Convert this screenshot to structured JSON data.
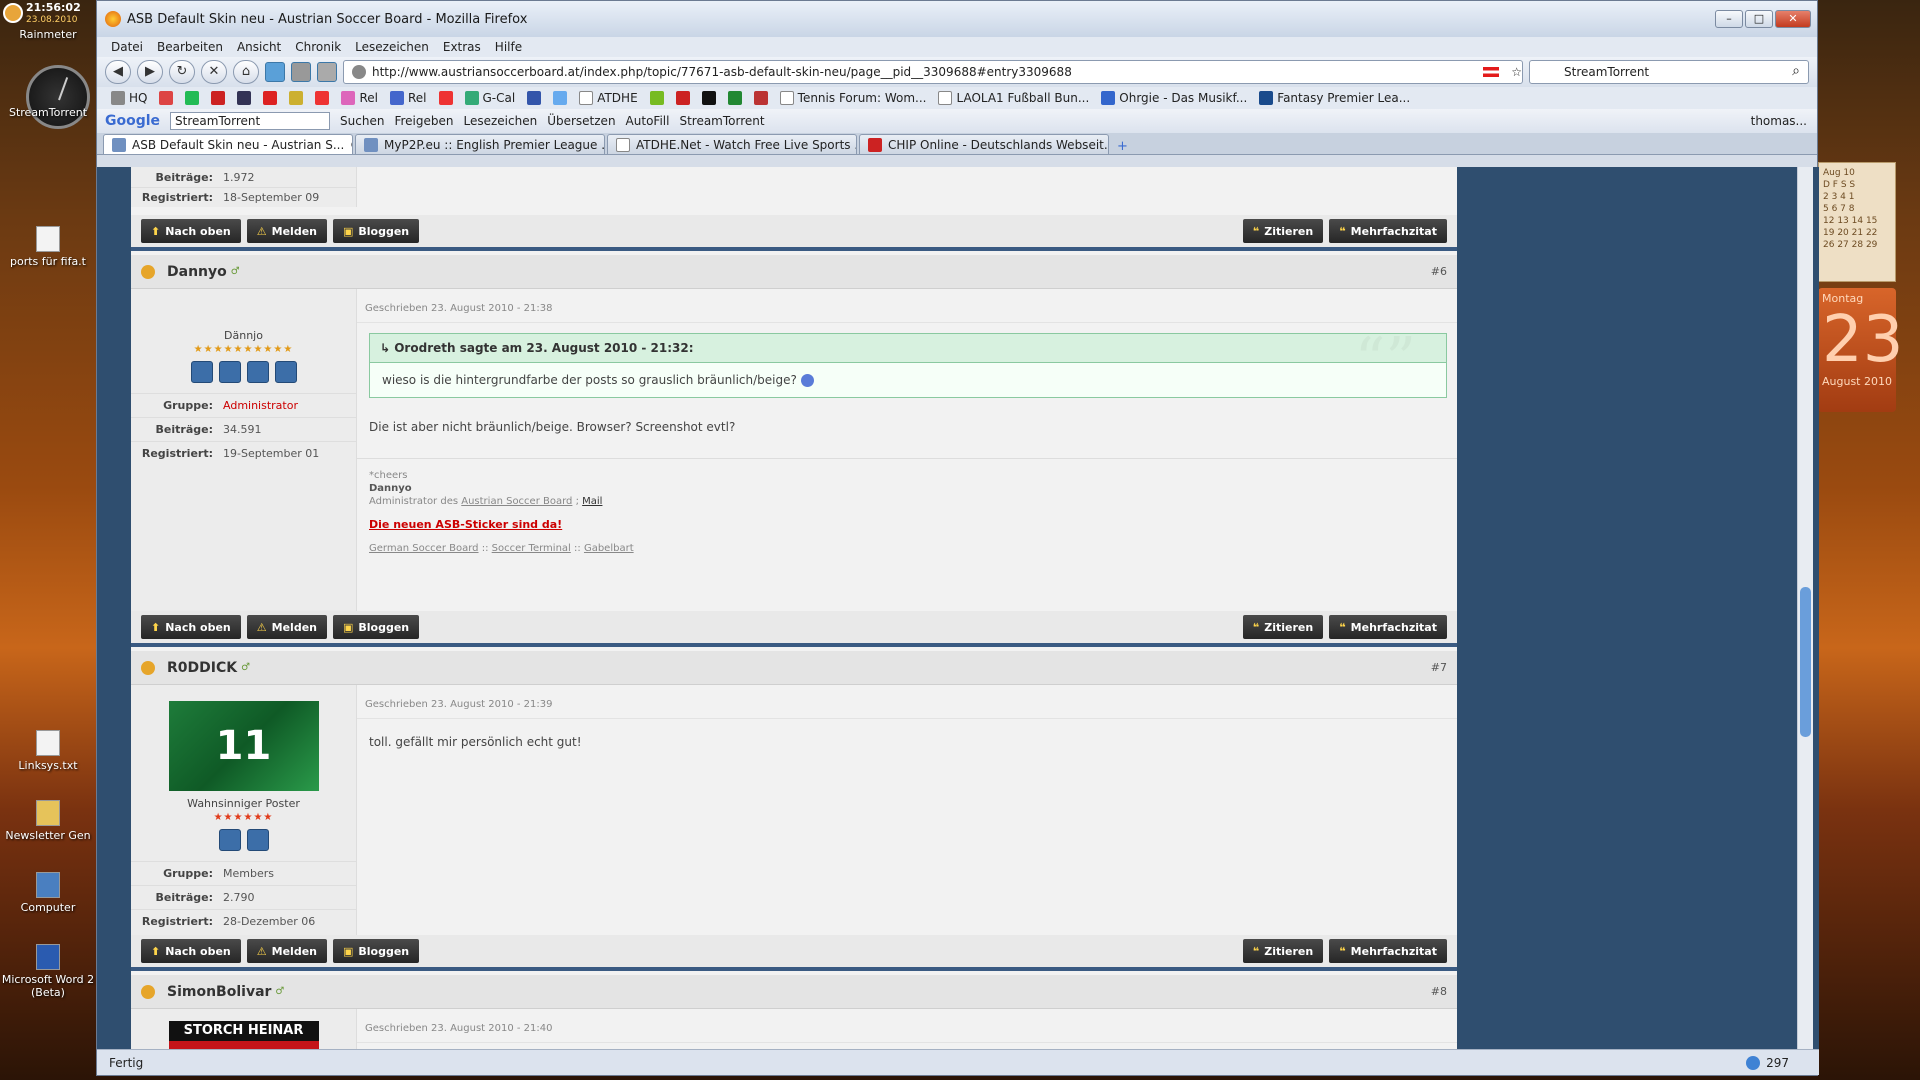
{
  "desktop": {
    "time": "21:56:02",
    "date": "23.08.2010",
    "icons": [
      {
        "label": "Rainmeter"
      },
      {
        "label": "StreamTorrent"
      },
      {
        "label": "ports für fifa.t"
      },
      {
        "label": "Linksys.txt"
      },
      {
        "label": "Newsletter Gen"
      },
      {
        "label": "Computer"
      },
      {
        "label": "Microsoft Word 2 (Beta)"
      }
    ],
    "calendar_header": "Aug 10",
    "calendar_rows": [
      "D F S S",
      "2 3 4 1",
      "5 6 7 8",
      "12 13 14 15",
      "19 20 21 22",
      "26 27 28 29"
    ],
    "day_label": "Montag",
    "day_number": "23",
    "month_label": "August 2010"
  },
  "window": {
    "title": "ASB Default Skin neu - Austrian Soccer Board - Mozilla Firefox",
    "menu": [
      "Datei",
      "Bearbeiten",
      "Ansicht",
      "Chronik",
      "Lesezeichen",
      "Extras",
      "Hilfe"
    ],
    "url": "http://www.austriansoccerboard.at/index.php/topic/77671-asb-default-skin-neu/page__pid__3309688#entry3309688",
    "search_value": "StreamTorrent",
    "bookmarks": [
      "HQ",
      "Rel",
      "Rel",
      "G-Cal",
      "ATDHE",
      "Tennis Forum: Wom...",
      "LAOLA1 Fußball Bun...",
      "Ohrgie - Das Musikf...",
      "Fantasy Premier Lea..."
    ],
    "google_bar": {
      "logo": "Google",
      "input": "StreamTorrent",
      "items": [
        "Suchen",
        "Freigeben",
        "Lesezeichen",
        "Übersetzen",
        "AutoFill",
        "StreamTorrent",
        "thomas..."
      ]
    },
    "tabs": [
      {
        "label": "ASB Default Skin neu - Austrian S...",
        "active": true
      },
      {
        "label": "MyP2P.eu :: English Premier League ...",
        "active": false
      },
      {
        "label": "ATDHE.Net - Watch Free Live Sports ...",
        "active": false
      },
      {
        "label": "CHIP Online - Deutschlands Webseit...",
        "active": false
      }
    ],
    "status": "Fertig",
    "status_count": "297"
  },
  "forum": {
    "buttons": {
      "top": "Nach oben",
      "report": "Melden",
      "blog": "Bloggen",
      "quote": "Zitieren",
      "multiquote": "Mehrfachzitat"
    },
    "labels": {
      "group": "Gruppe:",
      "posts": "Beiträge:",
      "registered": "Registriert:"
    },
    "prev_post": {
      "posts": "1.972",
      "registered": "18-September 09"
    },
    "posts": [
      {
        "user": "Dannyo",
        "num": "#6",
        "date": "Geschrieben 23. August 2010 - 21:38",
        "rank": "Dännjo",
        "stars": "★★★★★★★★★★",
        "group": "Administrator",
        "posts": "34.591",
        "registered": "19-September 01",
        "quote_header": "Orodreth sagte am 23. August 2010 - 21:32:",
        "quote_body": "wieso is die hintergrundfarbe der posts so grauslich bräunlich/beige?",
        "text": "Die ist aber nicht bräunlich/beige. Browser? Screenshot evtl?",
        "sig": {
          "cheers": "*cheers",
          "name": "Dannyo",
          "admin_prefix": "Administrator des",
          "asb_link": "Austrian Soccer Board",
          "sep": ";",
          "mail": "Mail",
          "sticker": "Die neuen ASB-Sticker sind da!",
          "link1": "German Soccer Board",
          "sep2": "::",
          "link2": "Soccer Terminal",
          "link3": "Gabelbart"
        }
      },
      {
        "user": "R0DDICK",
        "num": "#7",
        "date": "Geschrieben 23. August 2010 - 21:39",
        "avatar_text": "11",
        "rank": "Wahnsinniger Poster",
        "stars": "★★★★★★",
        "group": "Members",
        "posts": "2.790",
        "registered": "28-Dezember 06",
        "text": "toll. gefällt mir persönlich echt gut!"
      },
      {
        "user": "SimonBolivar",
        "num": "#8",
        "date": "Geschrieben 23. August 2010 - 21:40",
        "avatar_text": "STORCH HEINAR"
      }
    ]
  }
}
